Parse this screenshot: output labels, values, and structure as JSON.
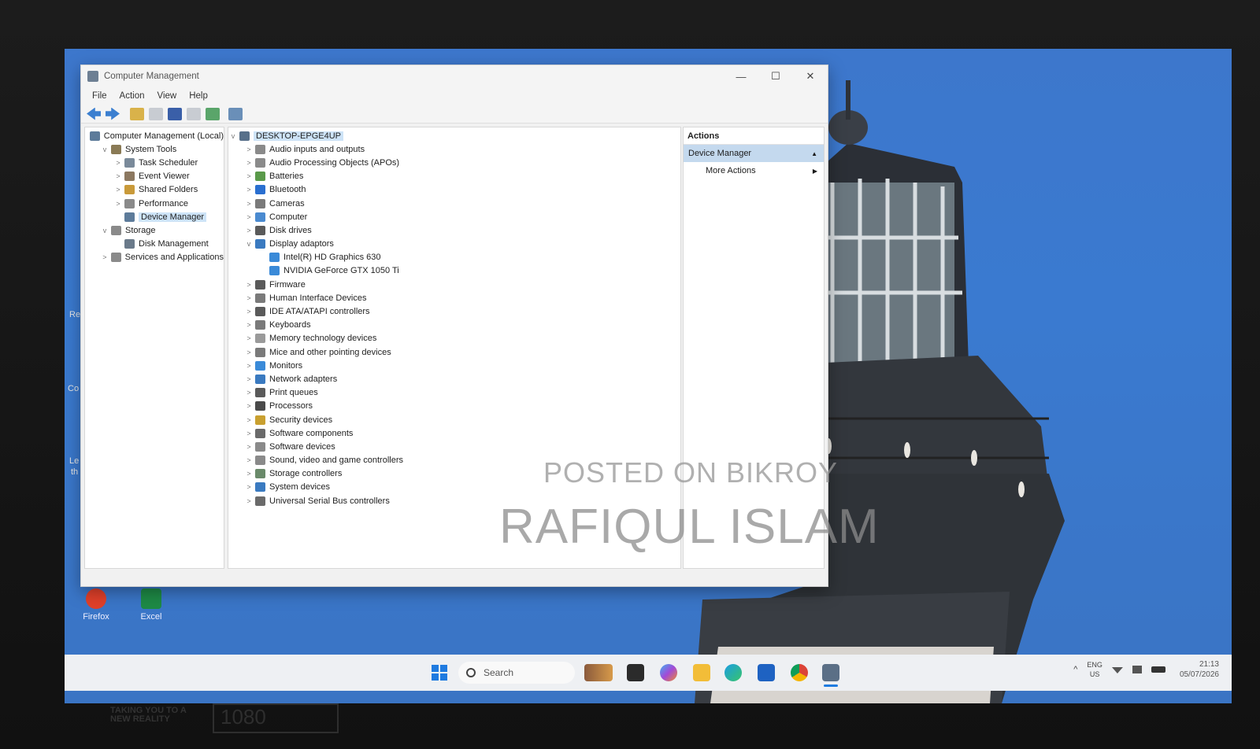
{
  "window": {
    "title": "Computer Management",
    "controls": {
      "minimize": "—",
      "maximize": "☐",
      "close": "✕"
    }
  },
  "menu": [
    "File",
    "Action",
    "View",
    "Help"
  ],
  "left_tree": [
    {
      "label": "Computer Management (Local)",
      "level": 0,
      "arrow": ""
    },
    {
      "label": "System Tools",
      "level": 1,
      "arrow": "v"
    },
    {
      "label": "Task Scheduler",
      "level": 2,
      "arrow": ">"
    },
    {
      "label": "Event Viewer",
      "level": 2,
      "arrow": ">"
    },
    {
      "label": "Shared Folders",
      "level": 2,
      "arrow": ">"
    },
    {
      "label": "Performance",
      "level": 2,
      "arrow": ">"
    },
    {
      "label": "Device Manager",
      "level": 2,
      "arrow": "",
      "selected": true
    },
    {
      "label": "Storage",
      "level": 1,
      "arrow": "v"
    },
    {
      "label": "Disk Management",
      "level": 2,
      "arrow": ""
    },
    {
      "label": "Services and Applications",
      "level": 1,
      "arrow": ">"
    }
  ],
  "device_tree": {
    "root": "DESKTOP-EPGE4UP",
    "items": [
      {
        "label": "Audio inputs and outputs",
        "arrow": ">"
      },
      {
        "label": "Audio Processing Objects (APOs)",
        "arrow": ">"
      },
      {
        "label": "Batteries",
        "arrow": ">"
      },
      {
        "label": "Bluetooth",
        "arrow": ">"
      },
      {
        "label": "Cameras",
        "arrow": ">"
      },
      {
        "label": "Computer",
        "arrow": ">"
      },
      {
        "label": "Disk drives",
        "arrow": ">"
      },
      {
        "label": "Display adaptors",
        "arrow": "v"
      },
      {
        "label": "Intel(R) HD Graphics 630",
        "arrow": "",
        "child": true
      },
      {
        "label": "NVIDIA GeForce GTX 1050 Ti",
        "arrow": "",
        "child": true
      },
      {
        "label": "Firmware",
        "arrow": ">"
      },
      {
        "label": "Human Interface Devices",
        "arrow": ">"
      },
      {
        "label": "IDE ATA/ATAPI controllers",
        "arrow": ">"
      },
      {
        "label": "Keyboards",
        "arrow": ">"
      },
      {
        "label": "Memory technology devices",
        "arrow": ">"
      },
      {
        "label": "Mice and other pointing devices",
        "arrow": ">"
      },
      {
        "label": "Monitors",
        "arrow": ">"
      },
      {
        "label": "Network adapters",
        "arrow": ">"
      },
      {
        "label": "Print queues",
        "arrow": ">"
      },
      {
        "label": "Processors",
        "arrow": ">"
      },
      {
        "label": "Security devices",
        "arrow": ">"
      },
      {
        "label": "Software components",
        "arrow": ">"
      },
      {
        "label": "Software devices",
        "arrow": ">"
      },
      {
        "label": "Sound, video and game controllers",
        "arrow": ">"
      },
      {
        "label": "Storage controllers",
        "arrow": ">"
      },
      {
        "label": "System devices",
        "arrow": ">"
      },
      {
        "label": "Universal Serial Bus controllers",
        "arrow": ">"
      }
    ]
  },
  "actions": {
    "header": "Actions",
    "selected": "Device Manager",
    "more": "More Actions"
  },
  "watermark": {
    "line1": "POSTED ON BIKROY",
    "line2": "RAFIQUL ISLAM"
  },
  "desktop_icons": [
    {
      "label": "Firefox"
    },
    {
      "label": "Excel"
    }
  ],
  "desktop_fragments": [
    "Re",
    "Co",
    "Le",
    "th"
  ],
  "taskbar": {
    "search_placeholder": "Search",
    "tray": {
      "lang": "ENG",
      "region": "US",
      "time": "21:13",
      "date": "05/07/2026"
    }
  },
  "bezel": {
    "tagline_1": "TAKING YOU TO A",
    "tagline_2": "NEW REALITY",
    "badge": "1080"
  },
  "colors": {
    "wallpaper": "#3a7ad0",
    "selection": "#c4d9ee",
    "start": "#1f7be0"
  }
}
